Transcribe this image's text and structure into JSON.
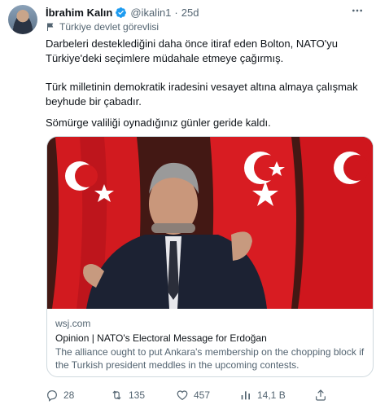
{
  "author": {
    "name": "İbrahim Kalın",
    "handle": "@ikalin1",
    "separator": "·",
    "time": "25d"
  },
  "label": "Türkiye devlet görevlisi",
  "tweet": {
    "paragraph1": "Darbeleri desteklediğini daha önce itiraf eden Bolton, NATO'yu Türkiye'deki seçimlere müdahale etmeye çağırmış.",
    "paragraph2": "Türk milletinin demokratik iradesini vesayet altına almaya çalışmak beyhude bir çabadır.",
    "paragraph3": "Sömürge valiliği oynadığınız günler geride kaldı."
  },
  "card": {
    "domain": "wsj.com",
    "title": "Opinion | NATO's Electoral Message for Erdoğan",
    "description": "The alliance ought to put Ankara's membership on the chopping block if the Turkish president meddles in the upcoming contests."
  },
  "actions": {
    "replies": "28",
    "retweets": "135",
    "likes": "457",
    "views": "14,1 B"
  },
  "colors": {
    "verified": "#1d9bf0",
    "flag_red": "#e30a17",
    "secondary_text": "#536471"
  },
  "icons": {
    "verified": "verified-badge-icon",
    "label": "flag-icon",
    "more": "more-icon",
    "reply": "reply-icon",
    "retweet": "retweet-icon",
    "like": "heart-icon",
    "views": "views-icon",
    "share": "share-icon"
  }
}
